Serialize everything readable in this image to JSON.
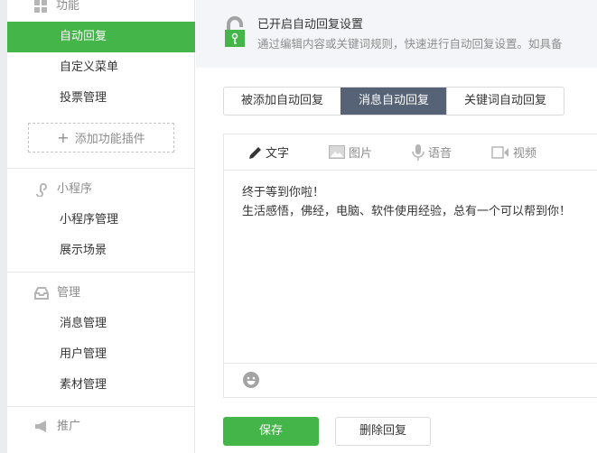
{
  "sidebar": {
    "sections": [
      {
        "title": "功能",
        "items": [
          "自动回复",
          "自定义菜单",
          "投票管理"
        ],
        "add_plugin": "添加功能插件"
      },
      {
        "title": "小程序",
        "items": [
          "小程序管理",
          "展示场景"
        ]
      },
      {
        "title": "管理",
        "items": [
          "消息管理",
          "用户管理",
          "素材管理"
        ]
      },
      {
        "title": "推广",
        "items": []
      }
    ],
    "active_item": "自动回复"
  },
  "banner": {
    "title": "已开启自动回复设置",
    "description": "通过编辑内容或关键词规则，快速进行自动回复设置。如具备"
  },
  "tabs": [
    "被添加自动回复",
    "消息自动回复",
    "关键词自动回复"
  ],
  "active_tab": "消息自动回复",
  "editor": {
    "tools": [
      "文字",
      "图片",
      "语音",
      "视频"
    ],
    "active_tool": "文字",
    "lines": [
      "终于等到你啦！",
      "生活感悟，佛经，电脑、软件使用经验，总有一个可以帮到你！"
    ]
  },
  "buttons": {
    "save": "保存",
    "delete": "删除回复"
  },
  "colors": {
    "accent": "#44b549",
    "tab_active": "#566275"
  }
}
